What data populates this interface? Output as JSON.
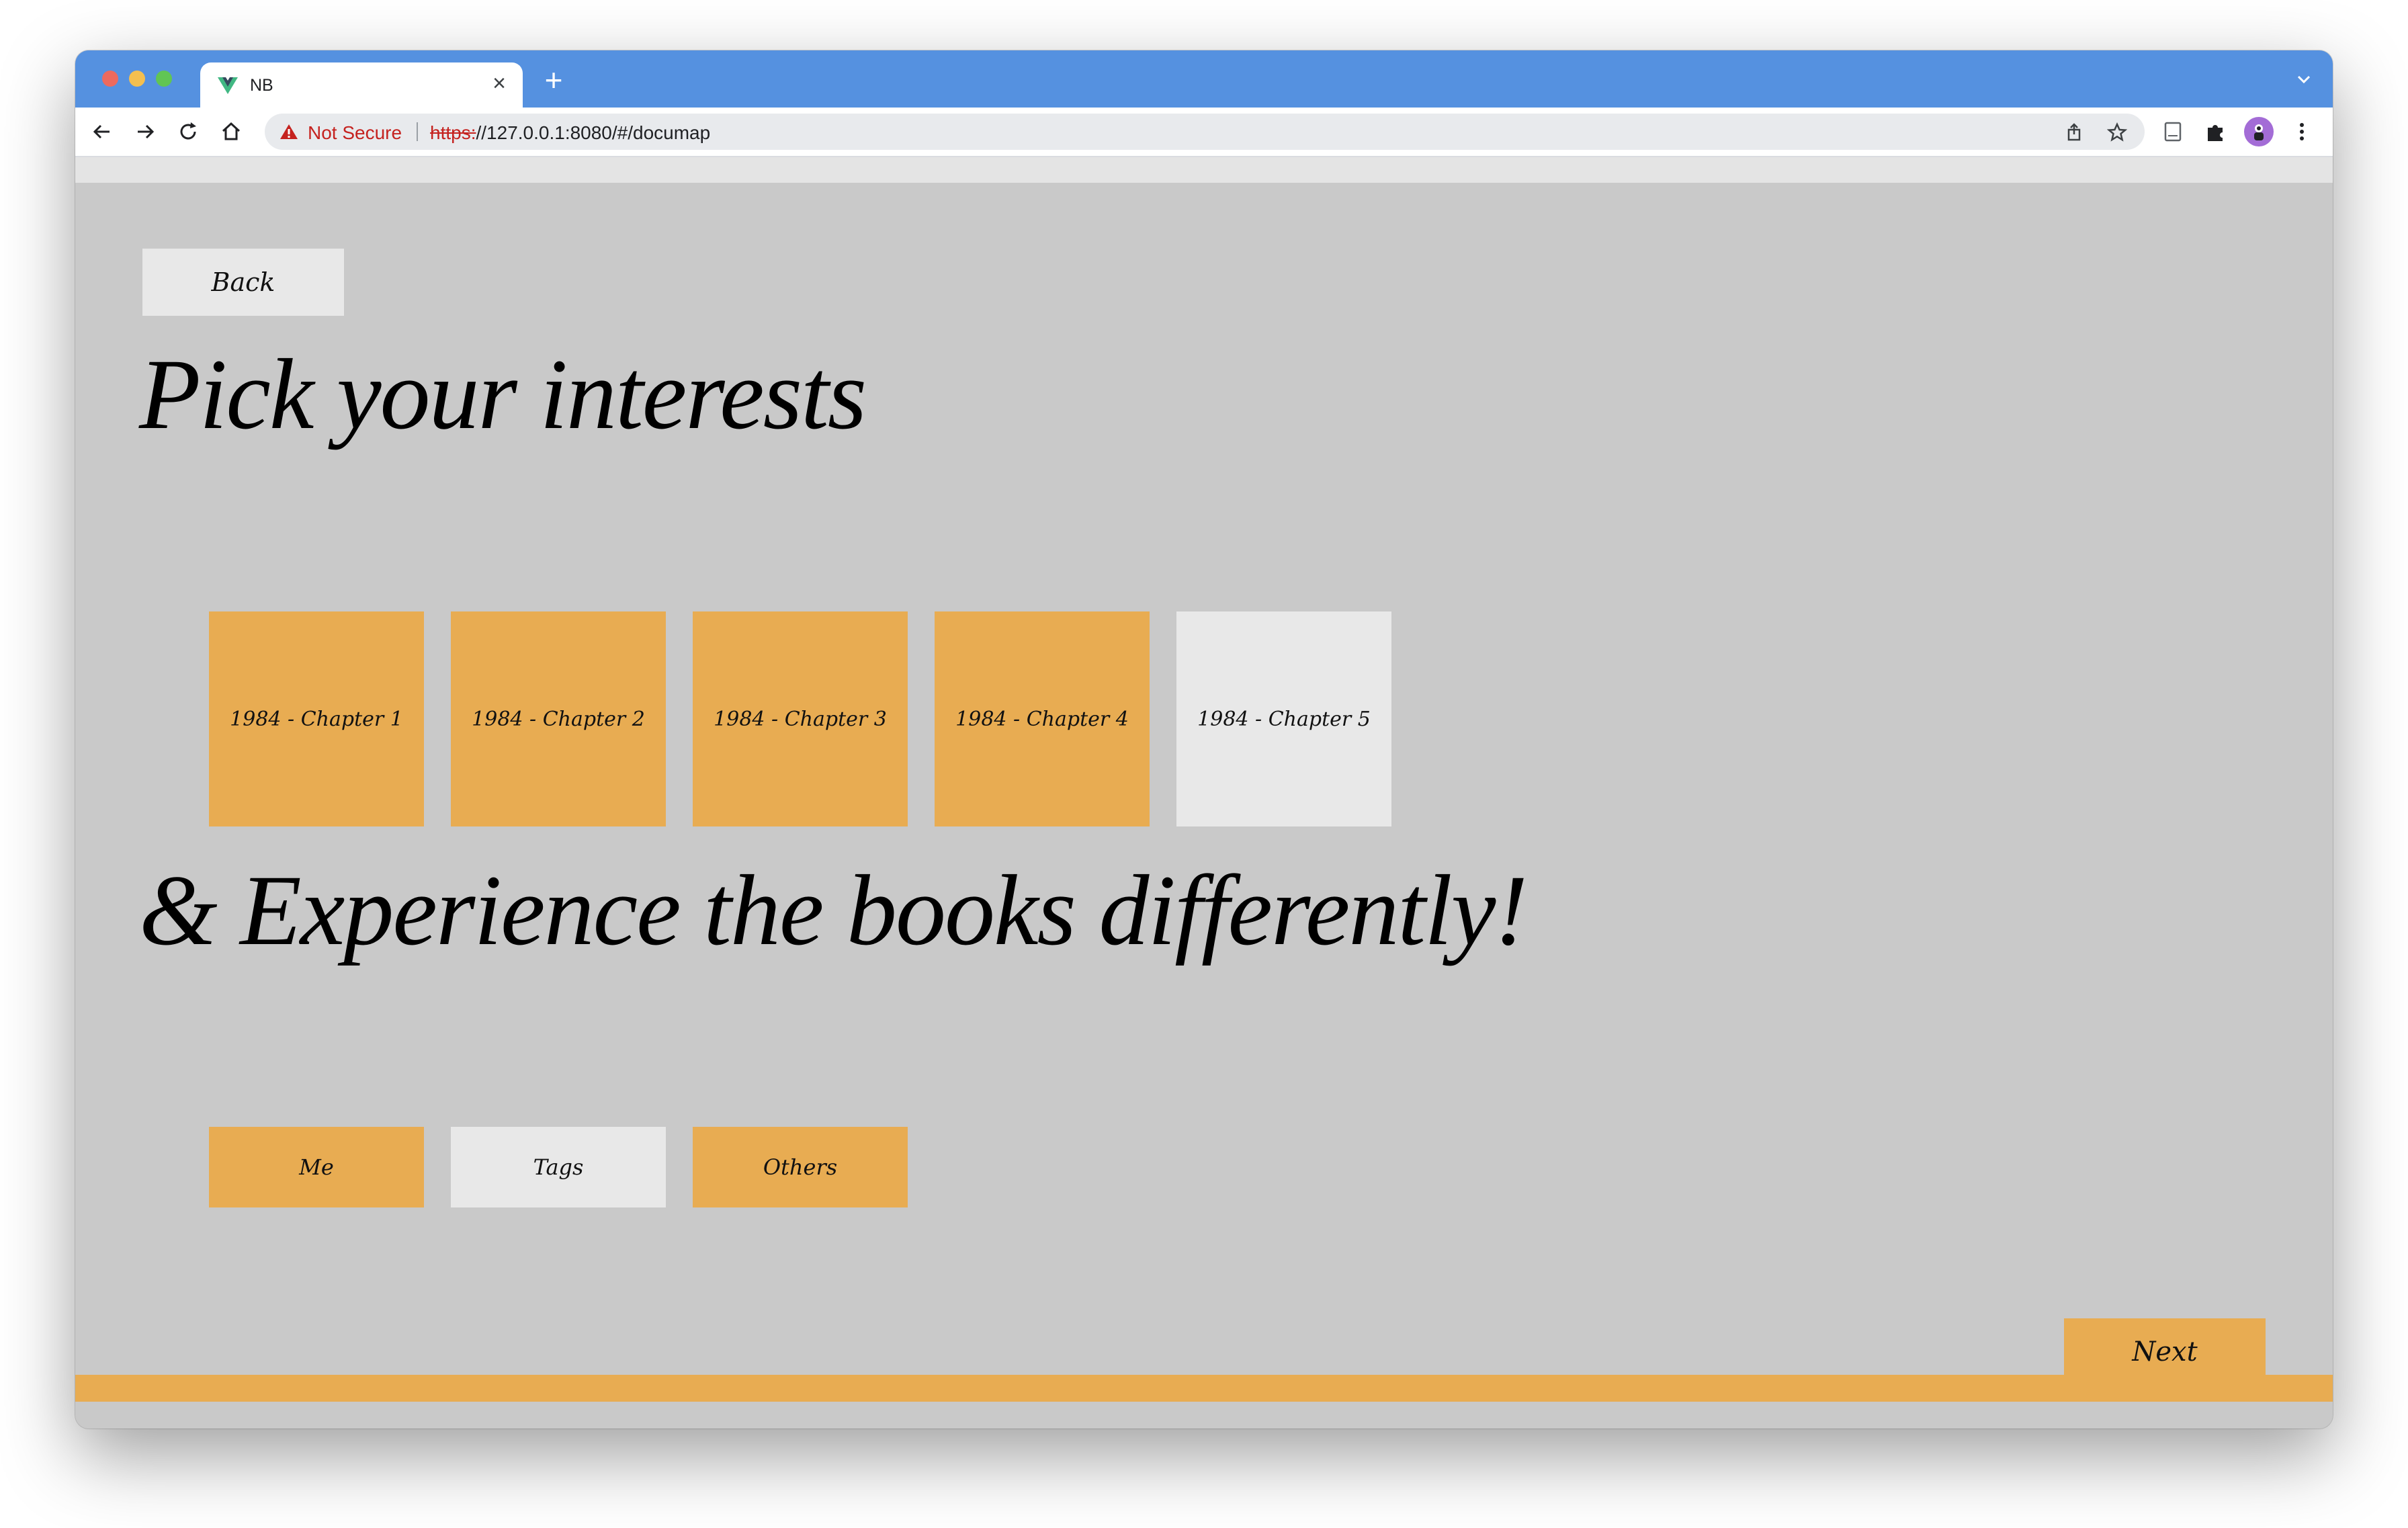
{
  "browser": {
    "tab_title": "NB",
    "security_label": "Not Secure",
    "url_scheme": "https:",
    "url_rest": "//127.0.0.1:8080/#/documap",
    "icons": {
      "favicon": "vue-logo-icon",
      "close": "close-icon",
      "new_tab": "plus-icon",
      "tab_search": "chevron-down-icon",
      "back": "arrow-left-icon",
      "forward": "arrow-right-icon",
      "reload": "reload-icon",
      "home": "home-icon",
      "warning": "warning-triangle-icon",
      "share": "share-icon",
      "bookmark": "star-icon",
      "reading_list": "reading-list-icon",
      "extensions": "puzzle-icon",
      "profile": "profile-avatar",
      "menu": "kebab-menu-icon"
    }
  },
  "page": {
    "back_label": "Back",
    "heading_interests": "Pick your interests",
    "chapters": [
      {
        "label": "1984 - Chapter 1",
        "selected": true
      },
      {
        "label": "1984 - Chapter 2",
        "selected": true
      },
      {
        "label": "1984 - Chapter 3",
        "selected": true
      },
      {
        "label": "1984 - Chapter 4",
        "selected": true
      },
      {
        "label": "1984 - Chapter 5",
        "selected": false
      }
    ],
    "heading_experience": "& Experience the books differently!",
    "modes": [
      {
        "label": "Me",
        "selected": true
      },
      {
        "label": "Tags",
        "selected": false
      },
      {
        "label": "Others",
        "selected": true
      }
    ],
    "next_label": "Next"
  },
  "colors": {
    "accent": "#e8ac52",
    "unselected": "#e8e8e8",
    "background": "#c9c9c9",
    "browser_chrome": "#5591e0"
  }
}
